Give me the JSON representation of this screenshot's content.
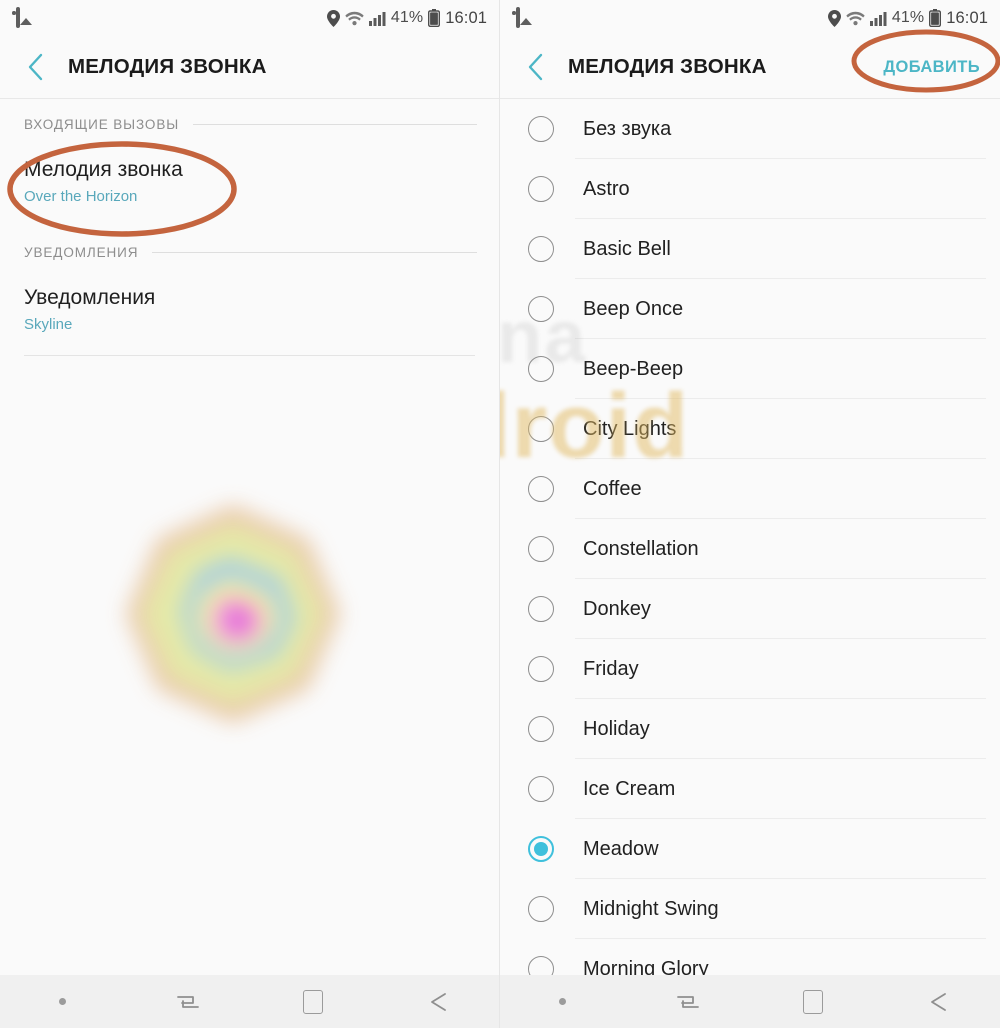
{
  "status_bar": {
    "left_icon": "gallery-icon",
    "icons": [
      "location-pin-icon",
      "wifi-icon",
      "signal-bars-icon",
      "battery-icon"
    ],
    "battery_percent": "41%",
    "clock": "16:01"
  },
  "colors": {
    "accent_teal": "#4cb6c6",
    "annotation_orange": "#c4643e",
    "selected_radio": "#3fc0dc",
    "subtitle_link": "#59a8bb",
    "background": "#fafafa",
    "navbar": "#f0f0f0"
  },
  "left_panel": {
    "appbar": {
      "back_icon": "back-chevron-icon",
      "title": "МЕЛОДИЯ ЗВОНКА"
    },
    "sections": [
      {
        "header": "ВХОДЯЩИЕ ВЫЗОВЫ",
        "row": {
          "title": "Мелодия звонка",
          "subtitle": "Over the Horizon"
        }
      },
      {
        "header": "УВЕДОМЛЕНИЯ",
        "row": {
          "title": "Уведомления",
          "subtitle": "Skyline"
        }
      }
    ]
  },
  "right_panel": {
    "appbar": {
      "back_icon": "back-chevron-icon",
      "title": "МЕЛОДИЯ ЗВОНКА",
      "action_label": "ДОБАВИТЬ"
    },
    "ringtones": [
      {
        "label": "Без звука",
        "selected": false
      },
      {
        "label": "Astro",
        "selected": false
      },
      {
        "label": "Basic Bell",
        "selected": false
      },
      {
        "label": "Beep Once",
        "selected": false
      },
      {
        "label": "Beep-Beep",
        "selected": false
      },
      {
        "label": "City Lights",
        "selected": false
      },
      {
        "label": "Coffee",
        "selected": false
      },
      {
        "label": "Constellation",
        "selected": false
      },
      {
        "label": "Donkey",
        "selected": false
      },
      {
        "label": "Friday",
        "selected": false
      },
      {
        "label": "Holiday",
        "selected": false
      },
      {
        "label": "Ice Cream",
        "selected": false
      },
      {
        "label": "Meadow",
        "selected": true
      },
      {
        "label": "Midnight Swing",
        "selected": false
      },
      {
        "label": "Morning Glory",
        "selected": false
      }
    ]
  },
  "watermark": {
    "line1": "kak na",
    "line2": "android"
  },
  "nav_bar": {
    "items": [
      "notification-dot-icon",
      "recents-icon",
      "home-icon",
      "back-arrow-icon"
    ]
  },
  "annotations": [
    {
      "name": "ringtone-setting-highlight",
      "target": "Мелодия звонка"
    },
    {
      "name": "add-button-highlight",
      "target": "ДОБАВИТЬ"
    }
  ]
}
